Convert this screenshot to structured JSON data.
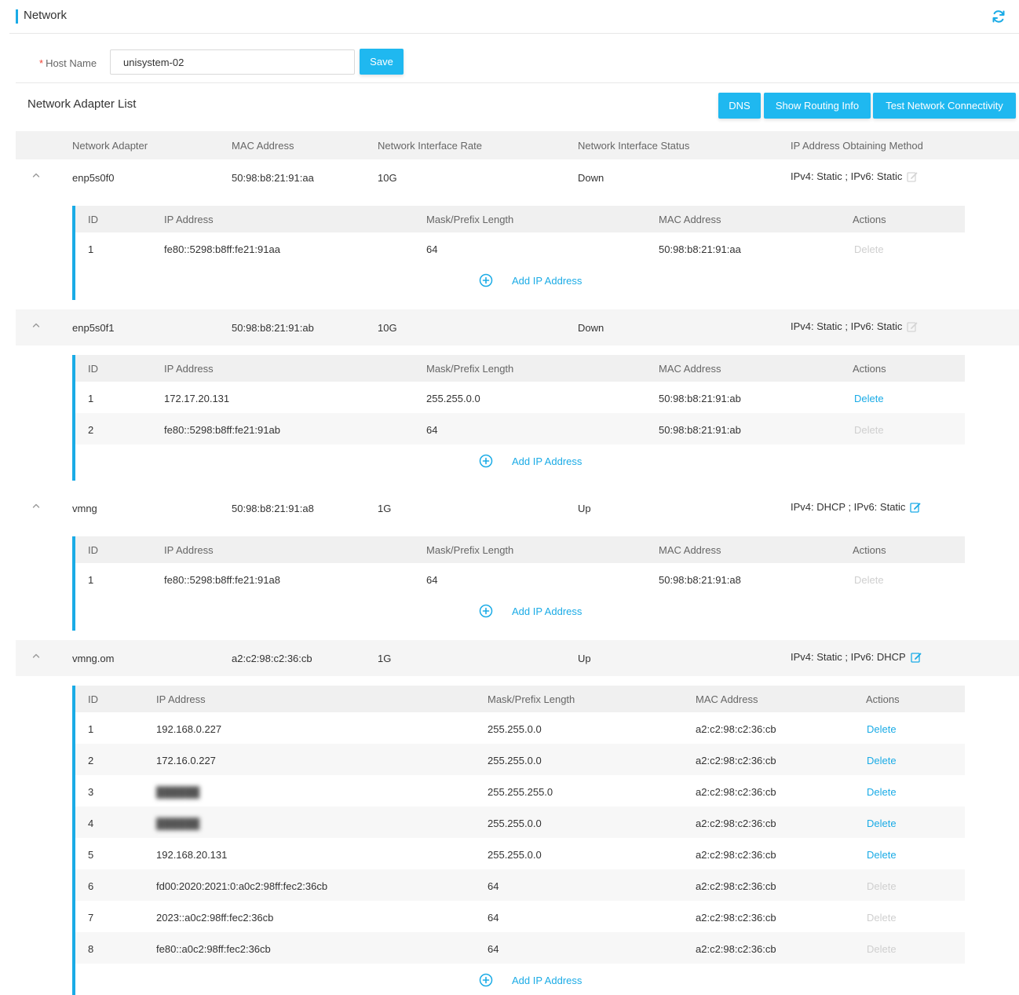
{
  "header": {
    "title": "Network",
    "refresh_icon": "refresh-icon"
  },
  "host": {
    "label": "Host Name",
    "required_mark": "*",
    "value": "unisystem-02",
    "save_label": "Save"
  },
  "adapter_list": {
    "title": "Network Adapter List",
    "buttons": {
      "dns": "DNS",
      "routing": "Show Routing Info",
      "test": "Test Network Connectivity"
    },
    "columns": [
      "Network Adapter",
      "MAC Address",
      "Network Interface Rate",
      "Network Interface Status",
      "IP Address Obtaining Method"
    ],
    "sub_columns": [
      "ID",
      "IP Address",
      "Mask/Prefix Length",
      "MAC Address",
      "Actions"
    ],
    "add_label": "Add IP Address",
    "delete_label": "Delete",
    "adapters": [
      {
        "name": "enp5s0f0",
        "mac": "50:98:b8:21:91:aa",
        "rate": "10G",
        "status": "Down",
        "method": "IPv4: Static ; IPv6: Static",
        "editable": false,
        "ips": [
          {
            "id": "1",
            "ip": "fe80::5298:b8ff:fe21:91aa",
            "mask": "64",
            "mac": "50:98:b8:21:91:aa",
            "deletable": false
          }
        ]
      },
      {
        "name": "enp5s0f1",
        "mac": "50:98:b8:21:91:ab",
        "rate": "10G",
        "status": "Down",
        "method": "IPv4: Static ; IPv6: Static",
        "editable": false,
        "ips": [
          {
            "id": "1",
            "ip": "172.17.20.131",
            "mask": "255.255.0.0",
            "mac": "50:98:b8:21:91:ab",
            "deletable": true
          },
          {
            "id": "2",
            "ip": "fe80::5298:b8ff:fe21:91ab",
            "mask": "64",
            "mac": "50:98:b8:21:91:ab",
            "deletable": false
          }
        ]
      },
      {
        "name": "vmng",
        "mac": "50:98:b8:21:91:a8",
        "rate": "1G",
        "status": "Up",
        "method": "IPv4: DHCP ; IPv6: Static",
        "editable": true,
        "ips": [
          {
            "id": "1",
            "ip": "fe80::5298:b8ff:fe21:91a8",
            "mask": "64",
            "mac": "50:98:b8:21:91:a8",
            "deletable": false
          }
        ]
      },
      {
        "name": "vmng.om",
        "mac": "a2:c2:98:c2:36:cb",
        "rate": "1G",
        "status": "Up",
        "method": "IPv4: Static ; IPv6: DHCP",
        "editable": true,
        "ips": [
          {
            "id": "1",
            "ip": "192.168.0.227",
            "mask": "255.255.0.0",
            "mac": "a2:c2:98:c2:36:cb",
            "deletable": true
          },
          {
            "id": "2",
            "ip": "172.16.0.227",
            "mask": "255.255.0.0",
            "mac": "a2:c2:98:c2:36:cb",
            "deletable": true
          },
          {
            "id": "3",
            "ip": "",
            "mask": "255.255.255.0",
            "mac": "a2:c2:98:c2:36:cb",
            "deletable": true
          },
          {
            "id": "4",
            "ip": "",
            "mask": "255.255.0.0",
            "mac": "a2:c2:98:c2:36:cb",
            "deletable": true
          },
          {
            "id": "5",
            "ip": "192.168.20.131",
            "mask": "255.255.0.0",
            "mac": "a2:c2:98:c2:36:cb",
            "deletable": true
          },
          {
            "id": "6",
            "ip": "fd00:2020:2021:0:a0c2:98ff:fec2:36cb",
            "mask": "64",
            "mac": "a2:c2:98:c2:36:cb",
            "deletable": false
          },
          {
            "id": "7",
            "ip": "2023::a0c2:98ff:fec2:36cb",
            "mask": "64",
            "mac": "a2:c2:98:c2:36:cb",
            "deletable": false
          },
          {
            "id": "8",
            "ip": "fe80::a0c2:98ff:fec2:36cb",
            "mask": "64",
            "mac": "a2:c2:98:c2:36:cb",
            "deletable": false
          }
        ]
      }
    ]
  },
  "colors": {
    "accent": "#1aabe6",
    "button": "#1fb8f0",
    "disabled": "#cfcfcf"
  }
}
